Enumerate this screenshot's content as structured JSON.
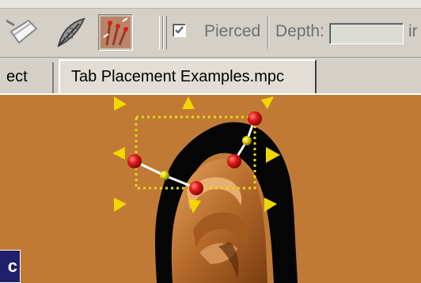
{
  "toolbar": {
    "pierced_label": "Pierced",
    "pierced_checked": true,
    "depth_label": "Depth:",
    "depth_value": "",
    "cut_off_label": "ir"
  },
  "tabs": [
    {
      "label": "ect"
    },
    {
      "label": "Tab Placement Examples.mpc"
    }
  ],
  "corner_label": "c",
  "colors": {
    "canvas_bg": "#c07a35",
    "handle": "#f2d600",
    "node": "#e21d1d",
    "selection_box": "#e8d21a"
  },
  "icons": [
    "tool-icon-eraser",
    "feather-icon",
    "tab-placement-icon"
  ]
}
